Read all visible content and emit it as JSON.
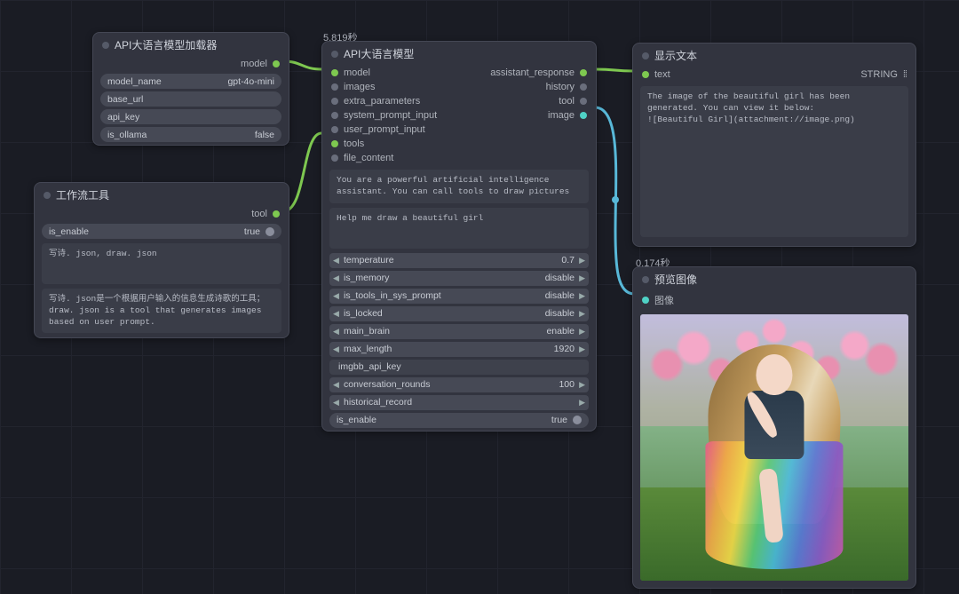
{
  "timing": {
    "llm_node": "5.819秒",
    "preview_node": "0.174秒"
  },
  "loader": {
    "title": "API大语言模型加载器",
    "out_port": "model",
    "params": [
      {
        "label": "model_name",
        "value": "gpt-4o-mini"
      },
      {
        "label": "base_url",
        "value": ""
      },
      {
        "label": "api_key",
        "value": ""
      },
      {
        "label": "is_ollama",
        "value": "false"
      }
    ]
  },
  "tool": {
    "title": "工作流工具",
    "out_port": "tool",
    "enable_label": "is_enable",
    "enable_value": "true",
    "text1": "写诗. json, draw. json",
    "text2": "写诗. json是一个根据用户输入的信息生成诗歌的工具；draw. json is a tool that generates images based on user prompt."
  },
  "llm": {
    "title": "API大语言模型",
    "inputs": [
      "model",
      "images",
      "extra_parameters",
      "system_prompt_input",
      "user_prompt_input",
      "tools",
      "file_content"
    ],
    "outputs": [
      "assistant_response",
      "history",
      "tool",
      "image"
    ],
    "system_prompt": "You are a powerful artificial intelligence assistant. You can call tools to draw pictures",
    "user_prompt": "Help me draw a beautiful girl",
    "sliders": [
      {
        "label": "temperature",
        "value": "0.7"
      },
      {
        "label": "is_memory",
        "value": "disable"
      },
      {
        "label": "is_tools_in_sys_prompt",
        "value": "disable"
      },
      {
        "label": "is_locked",
        "value": "disable"
      },
      {
        "label": "main_brain",
        "value": "enable"
      },
      {
        "label": "max_length",
        "value": "1920"
      }
    ],
    "imgbb_label": "imgbb_api_key",
    "sliders2": [
      {
        "label": "conversation_rounds",
        "value": "100"
      },
      {
        "label": "historical_record",
        "value": ""
      }
    ],
    "enable_label": "is_enable",
    "enable_value": "true"
  },
  "showtext": {
    "title": "显示文本",
    "in_port": "text",
    "out_port": "STRING",
    "content": "The image of the beautiful girl has been generated. You can view it below:\n![Beautiful Girl](attachment://image.png)"
  },
  "preview": {
    "title": "预览图像",
    "in_port": "图像"
  }
}
